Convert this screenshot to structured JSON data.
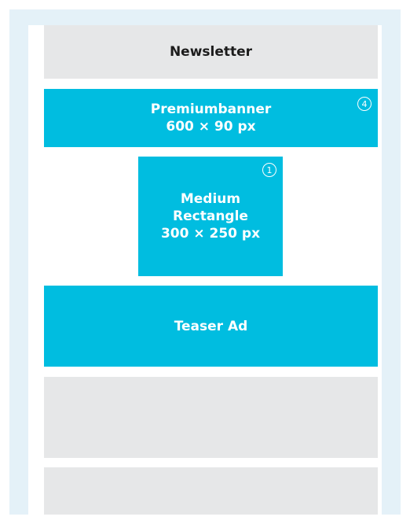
{
  "slots": {
    "newsletter": {
      "label": "Newsletter"
    },
    "premiumbanner": {
      "name": "Premiumbanner",
      "size": "600 × 90 px",
      "badge": "4"
    },
    "medium_rectangle": {
      "line1": "Medium",
      "line2": "Rectangle",
      "size": "300 × 250 px",
      "badge": "1"
    },
    "teaser_ad": {
      "label": "Teaser Ad"
    }
  },
  "colors": {
    "background_frame": "#e4f1f8",
    "ad_slot": "#00bde0",
    "content_block": "#e6e7e8",
    "page": "#ffffff"
  }
}
